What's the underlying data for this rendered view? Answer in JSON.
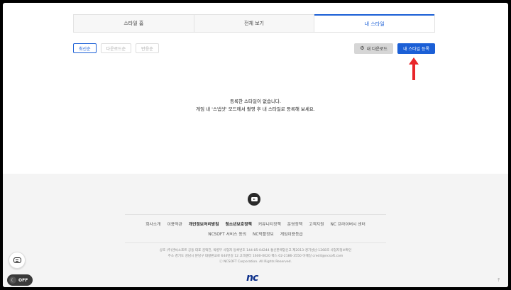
{
  "tabs": [
    {
      "label": "스타일 홈",
      "active": false
    },
    {
      "label": "전체 보기",
      "active": false
    },
    {
      "label": "내 스타일",
      "active": true
    }
  ],
  "sort": [
    {
      "label": "최신순",
      "active": true
    },
    {
      "label": "다운로드순",
      "active": false
    },
    {
      "label": "반응순",
      "active": false
    }
  ],
  "actions": {
    "download_label": "내 다운로드",
    "register_label": "내 스타일 등록"
  },
  "empty": {
    "line1": "등록한 스타일이 없습니다.",
    "line2": "게임 내 '스냅샷' 모드에서 촬영 후 내 스타일로 등록해 보세요."
  },
  "footer": {
    "links_row1": [
      {
        "label": "회사소개",
        "bold": false
      },
      {
        "label": "이용약관",
        "bold": false
      },
      {
        "label": "개인정보처리방침",
        "bold": true
      },
      {
        "label": "청소년보호정책",
        "bold": true
      },
      {
        "label": "커뮤니티정책",
        "bold": false
      },
      {
        "label": "운영정책",
        "bold": false
      },
      {
        "label": "고객지원",
        "bold": false
      },
      {
        "label": "NC 프라이버시 센터",
        "bold": false
      }
    ],
    "links_row2": [
      {
        "label": "NCSOFT 서비스 동의",
        "bold": false
      },
      {
        "label": "NC락플정보",
        "bold": false
      },
      {
        "label": "게임이용등급",
        "bold": false
      }
    ],
    "company_line1": "상호 (주)엔씨소프트 공동 대표 김택진, 박병무 사업자 등록번호 144-85-04244 통신판매업신고 제2013-경기성남-1268호 사업자정보확인",
    "company_line2": "주소 경기도 성남시 분당구 대왕판교로 644번길 12 고객센터 1600-0020 팩스 02-2186-3550 이메일 credit@ncsoft.com",
    "copyright": "ⓒ NCSOFT Corporation. All Rights Reserved.",
    "logo_text": "nc"
  },
  "widgets": {
    "toggle_label": "OFF"
  },
  "colors": {
    "accent": "#1b5fd6",
    "arrow": "#e8262a"
  }
}
